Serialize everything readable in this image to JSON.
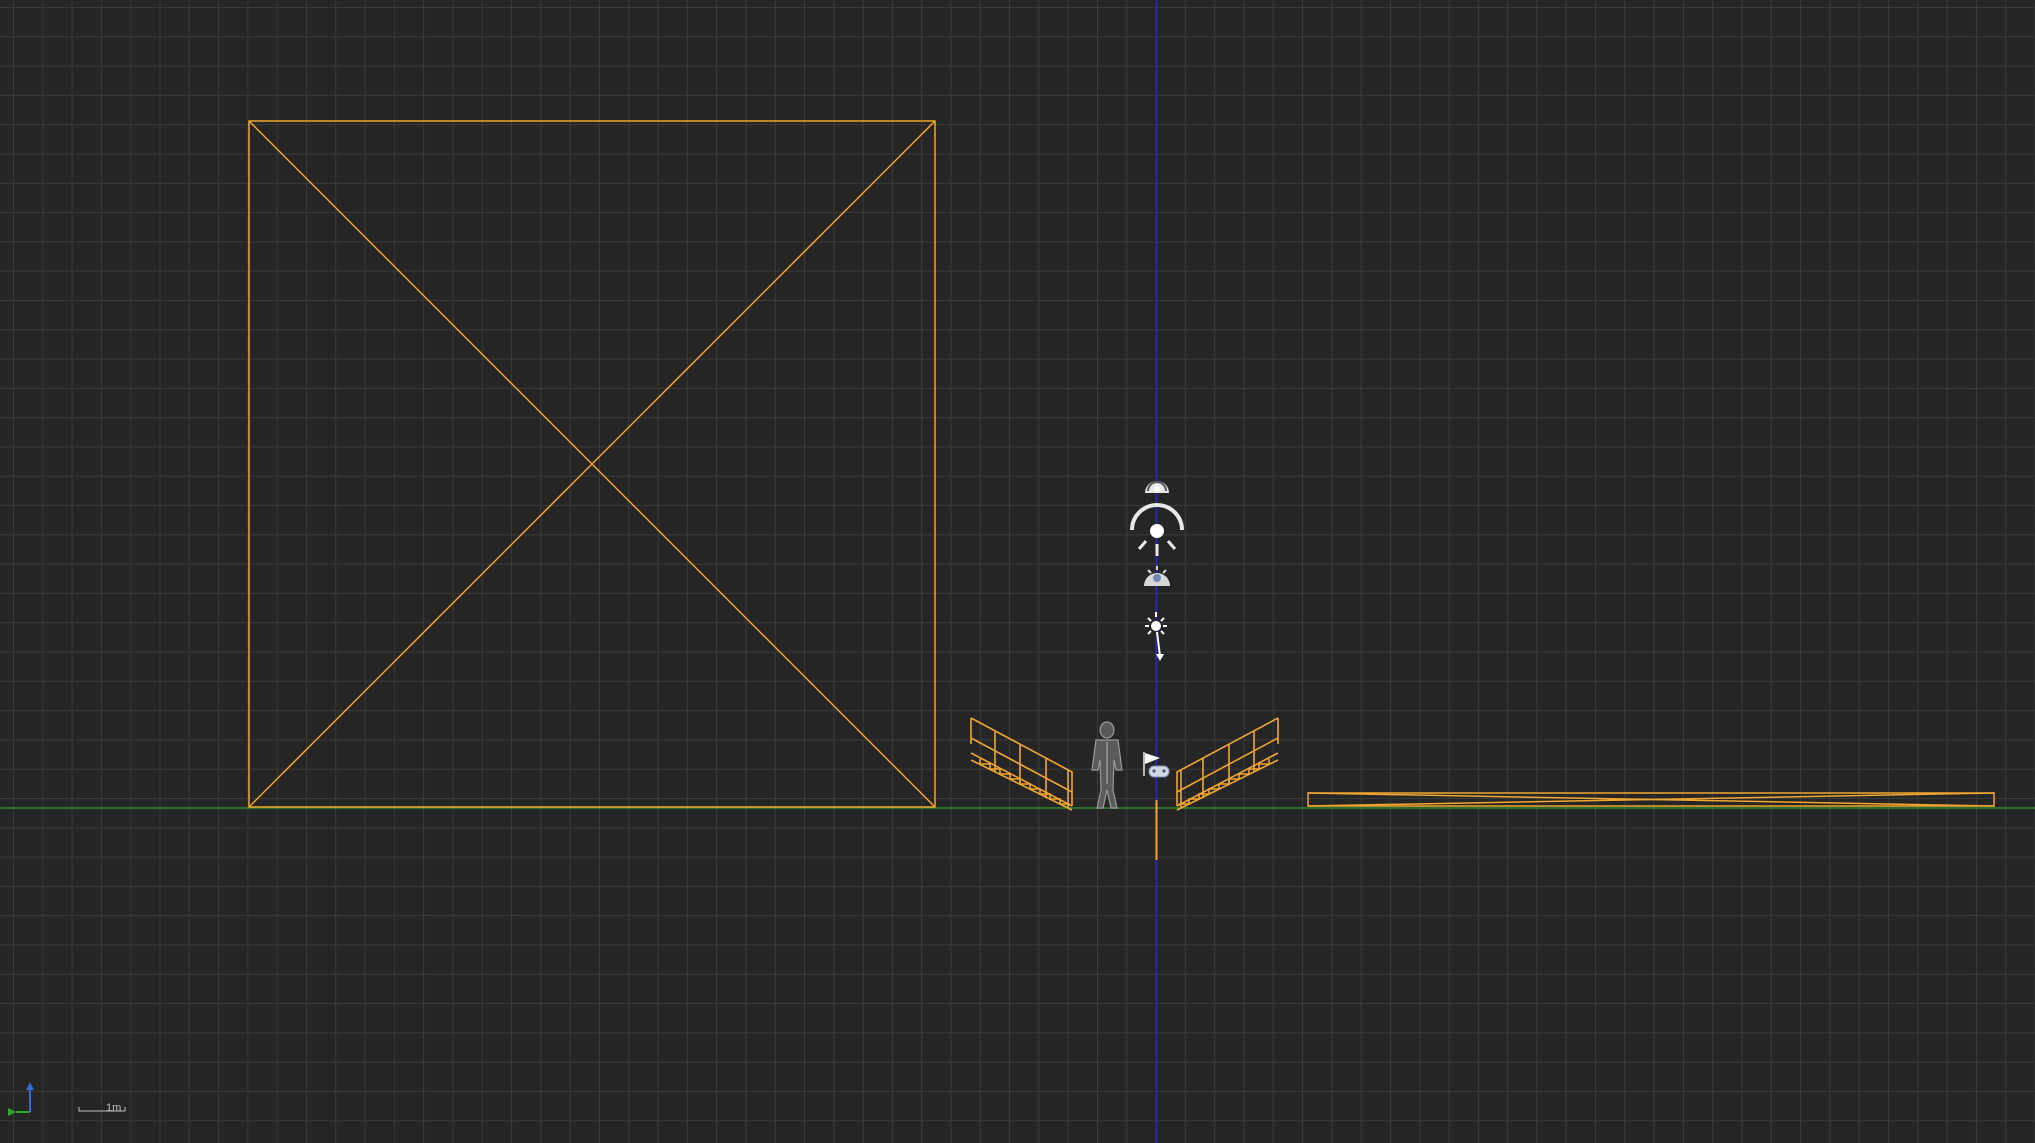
{
  "viewport": {
    "view": "orthographic-side",
    "grid_color": "#3a3a3a",
    "background_color": "#252525",
    "horizon_axis_color": "#2e8b2e",
    "vertical_axis_color": "#2a2ab0",
    "selection_color": "#f0a630"
  },
  "scale_indicator": {
    "label": "1m"
  },
  "axis_gizmo": {
    "axes": [
      "x-axis-green",
      "z-axis-blue"
    ]
  },
  "scene_objects": [
    {
      "name": "box-brush",
      "selected": true
    },
    {
      "name": "left-stair-railing",
      "selected": true
    },
    {
      "name": "character-mannequin",
      "selected": false
    },
    {
      "name": "player-start-flag",
      "selected": false
    },
    {
      "name": "right-stair-railing",
      "selected": true
    },
    {
      "name": "floor-plane",
      "selected": true
    },
    {
      "name": "sky-atmosphere-icon",
      "selected": false
    },
    {
      "name": "directional-light-icon",
      "selected": false
    },
    {
      "name": "skylight-icon",
      "selected": false
    },
    {
      "name": "exponential-fog-icon",
      "selected": false
    }
  ]
}
